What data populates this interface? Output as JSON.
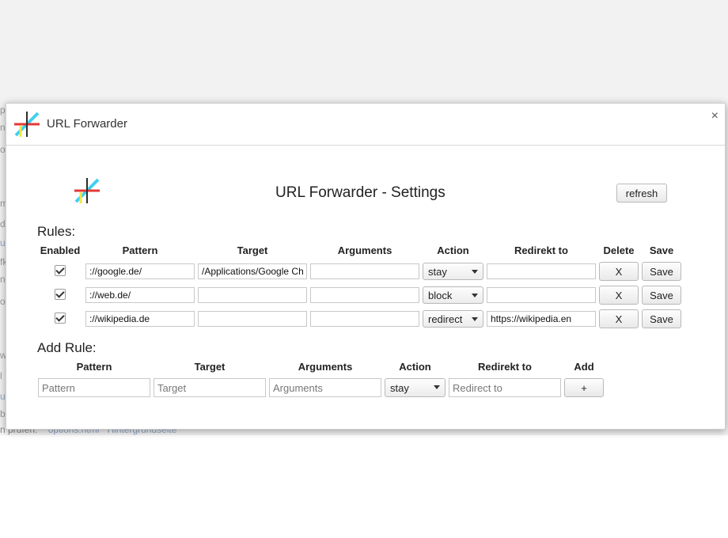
{
  "background": {
    "left_fragments": [
      "p",
      "n",
      "o",
      "m",
      "d",
      "u",
      "fk",
      "n",
      "o",
      "w",
      "l",
      "u",
      "b"
    ],
    "bottom_text": "n prüfen:",
    "bottom_links": [
      "options.html",
      "Hintergrundseite"
    ]
  },
  "dialog": {
    "title": "URL Forwarder",
    "close_symbol": "×"
  },
  "settings": {
    "title": "URL Forwarder - Settings",
    "refresh_label": "refresh"
  },
  "rules": {
    "section_title": "Rules:",
    "headers": [
      "Enabled",
      "Pattern",
      "Target",
      "Arguments",
      "Action",
      "Redirekt to",
      "Delete",
      "Save"
    ],
    "rows": [
      {
        "enabled": true,
        "pattern": "://google.de/",
        "target": "/Applications/Google Ch",
        "arguments": "",
        "action": "stay",
        "redirect_to": "",
        "delete_label": "X",
        "save_label": "Save"
      },
      {
        "enabled": true,
        "pattern": "://web.de/",
        "target": "",
        "arguments": "",
        "action": "block",
        "redirect_to": "",
        "delete_label": "X",
        "save_label": "Save"
      },
      {
        "enabled": true,
        "pattern": "://wikipedia.de",
        "target": "",
        "arguments": "",
        "action": "redirect",
        "redirect_to": "https://wikipedia.en",
        "delete_label": "X",
        "save_label": "Save"
      }
    ]
  },
  "add_rule": {
    "section_title": "Add Rule:",
    "headers": [
      "Pattern",
      "Target",
      "Arguments",
      "Action",
      "Redirekt to",
      "Add"
    ],
    "pattern_placeholder": "Pattern",
    "target_placeholder": "Target",
    "arguments_placeholder": "Arguments",
    "action": "stay",
    "redirect_placeholder": "Redirect to",
    "add_label": "+"
  },
  "colors": {
    "logo_cyan": "#3fd0ef",
    "logo_red": "#e53935",
    "logo_yellow": "#f5e642",
    "logo_dark": "#2c2c2c"
  }
}
